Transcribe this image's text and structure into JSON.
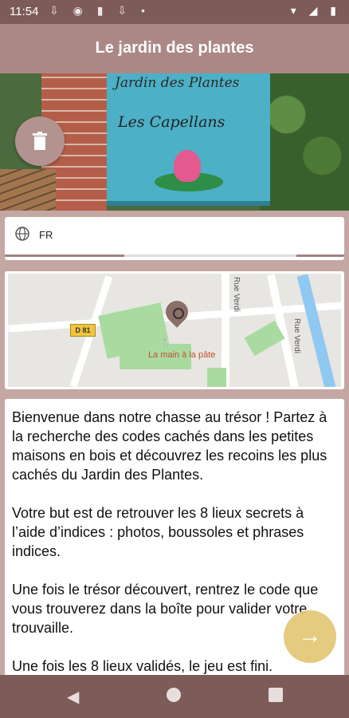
{
  "status_bar": {
    "time": "11:54",
    "left_icons": "⇩ ◉ ▮ ⇩ •",
    "right_icons": "▾ ◢ ▮"
  },
  "app_bar": {
    "title": "Le jardin des plantes"
  },
  "hero": {
    "sign_line1": "Jardin des Plantes",
    "sign_line2": "Les Capellans"
  },
  "delete_fab": {
    "icon": "trash-icon"
  },
  "language": {
    "icon": "globe-icon",
    "value": "FR"
  },
  "map": {
    "road_label": "D 81",
    "restaurant": "La main à la pâte",
    "street1": "Rue Verdi",
    "street2": "Rue Verdi",
    "pin_icon": "search-pin-icon"
  },
  "description": {
    "text": "Bienvenue dans notre chasse au trésor ! Partez à la recherche des codes cachés dans les petites maisons en bois et découvrez les recoins les plus cachés du Jardin des Plantes.\n\nVotre but est de retrouver les 8 lieux secrets à l’aide d’indices : photos, boussoles et phrases indices.\n\nUne fois le trésor découvert, rentrez le code que vous trouverez dans la boîte pour valider votre trouvaille.\n\nUne fois les 8 lieux validés, le jeu est fini."
  },
  "next_fab": {
    "icon": "arrow-right-icon"
  },
  "nav": {
    "back": "◀",
    "home": "home",
    "recent": "recent"
  },
  "colors": {
    "primary_dark": "#7d5b58",
    "primary": "#ab8886",
    "background": "#c4a7a3",
    "accent": "#e2c774"
  }
}
